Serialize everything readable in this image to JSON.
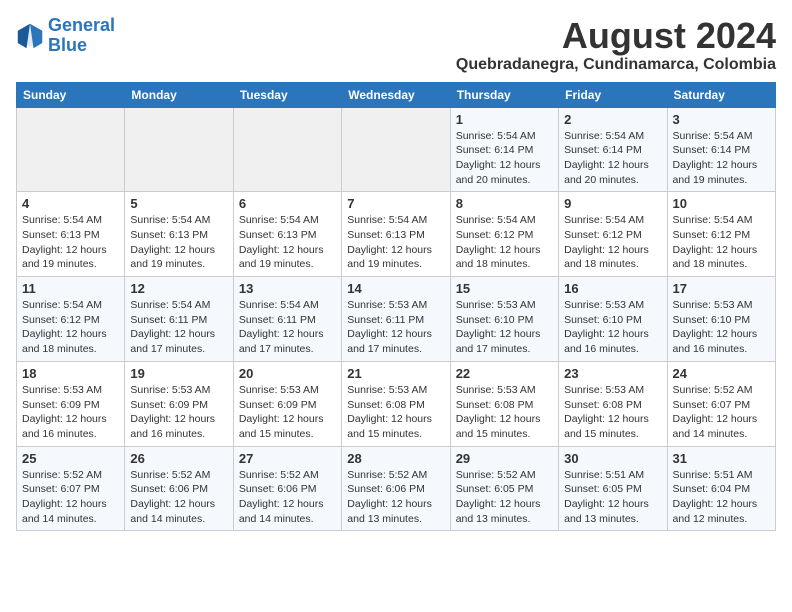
{
  "header": {
    "logo_line1": "General",
    "logo_line2": "Blue",
    "title": "August 2024",
    "subtitle": "Quebradanegra, Cundinamarca, Colombia"
  },
  "weekdays": [
    "Sunday",
    "Monday",
    "Tuesday",
    "Wednesday",
    "Thursday",
    "Friday",
    "Saturday"
  ],
  "weeks": [
    [
      {
        "day": "",
        "info": ""
      },
      {
        "day": "",
        "info": ""
      },
      {
        "day": "",
        "info": ""
      },
      {
        "day": "",
        "info": ""
      },
      {
        "day": "1",
        "info": "Sunrise: 5:54 AM\nSunset: 6:14 PM\nDaylight: 12 hours\nand 20 minutes."
      },
      {
        "day": "2",
        "info": "Sunrise: 5:54 AM\nSunset: 6:14 PM\nDaylight: 12 hours\nand 20 minutes."
      },
      {
        "day": "3",
        "info": "Sunrise: 5:54 AM\nSunset: 6:14 PM\nDaylight: 12 hours\nand 19 minutes."
      }
    ],
    [
      {
        "day": "4",
        "info": "Sunrise: 5:54 AM\nSunset: 6:13 PM\nDaylight: 12 hours\nand 19 minutes."
      },
      {
        "day": "5",
        "info": "Sunrise: 5:54 AM\nSunset: 6:13 PM\nDaylight: 12 hours\nand 19 minutes."
      },
      {
        "day": "6",
        "info": "Sunrise: 5:54 AM\nSunset: 6:13 PM\nDaylight: 12 hours\nand 19 minutes."
      },
      {
        "day": "7",
        "info": "Sunrise: 5:54 AM\nSunset: 6:13 PM\nDaylight: 12 hours\nand 19 minutes."
      },
      {
        "day": "8",
        "info": "Sunrise: 5:54 AM\nSunset: 6:12 PM\nDaylight: 12 hours\nand 18 minutes."
      },
      {
        "day": "9",
        "info": "Sunrise: 5:54 AM\nSunset: 6:12 PM\nDaylight: 12 hours\nand 18 minutes."
      },
      {
        "day": "10",
        "info": "Sunrise: 5:54 AM\nSunset: 6:12 PM\nDaylight: 12 hours\nand 18 minutes."
      }
    ],
    [
      {
        "day": "11",
        "info": "Sunrise: 5:54 AM\nSunset: 6:12 PM\nDaylight: 12 hours\nand 18 minutes."
      },
      {
        "day": "12",
        "info": "Sunrise: 5:54 AM\nSunset: 6:11 PM\nDaylight: 12 hours\nand 17 minutes."
      },
      {
        "day": "13",
        "info": "Sunrise: 5:54 AM\nSunset: 6:11 PM\nDaylight: 12 hours\nand 17 minutes."
      },
      {
        "day": "14",
        "info": "Sunrise: 5:53 AM\nSunset: 6:11 PM\nDaylight: 12 hours\nand 17 minutes."
      },
      {
        "day": "15",
        "info": "Sunrise: 5:53 AM\nSunset: 6:10 PM\nDaylight: 12 hours\nand 17 minutes."
      },
      {
        "day": "16",
        "info": "Sunrise: 5:53 AM\nSunset: 6:10 PM\nDaylight: 12 hours\nand 16 minutes."
      },
      {
        "day": "17",
        "info": "Sunrise: 5:53 AM\nSunset: 6:10 PM\nDaylight: 12 hours\nand 16 minutes."
      }
    ],
    [
      {
        "day": "18",
        "info": "Sunrise: 5:53 AM\nSunset: 6:09 PM\nDaylight: 12 hours\nand 16 minutes."
      },
      {
        "day": "19",
        "info": "Sunrise: 5:53 AM\nSunset: 6:09 PM\nDaylight: 12 hours\nand 16 minutes."
      },
      {
        "day": "20",
        "info": "Sunrise: 5:53 AM\nSunset: 6:09 PM\nDaylight: 12 hours\nand 15 minutes."
      },
      {
        "day": "21",
        "info": "Sunrise: 5:53 AM\nSunset: 6:08 PM\nDaylight: 12 hours\nand 15 minutes."
      },
      {
        "day": "22",
        "info": "Sunrise: 5:53 AM\nSunset: 6:08 PM\nDaylight: 12 hours\nand 15 minutes."
      },
      {
        "day": "23",
        "info": "Sunrise: 5:53 AM\nSunset: 6:08 PM\nDaylight: 12 hours\nand 15 minutes."
      },
      {
        "day": "24",
        "info": "Sunrise: 5:52 AM\nSunset: 6:07 PM\nDaylight: 12 hours\nand 14 minutes."
      }
    ],
    [
      {
        "day": "25",
        "info": "Sunrise: 5:52 AM\nSunset: 6:07 PM\nDaylight: 12 hours\nand 14 minutes."
      },
      {
        "day": "26",
        "info": "Sunrise: 5:52 AM\nSunset: 6:06 PM\nDaylight: 12 hours\nand 14 minutes."
      },
      {
        "day": "27",
        "info": "Sunrise: 5:52 AM\nSunset: 6:06 PM\nDaylight: 12 hours\nand 14 minutes."
      },
      {
        "day": "28",
        "info": "Sunrise: 5:52 AM\nSunset: 6:06 PM\nDaylight: 12 hours\nand 13 minutes."
      },
      {
        "day": "29",
        "info": "Sunrise: 5:52 AM\nSunset: 6:05 PM\nDaylight: 12 hours\nand 13 minutes."
      },
      {
        "day": "30",
        "info": "Sunrise: 5:51 AM\nSunset: 6:05 PM\nDaylight: 12 hours\nand 13 minutes."
      },
      {
        "day": "31",
        "info": "Sunrise: 5:51 AM\nSunset: 6:04 PM\nDaylight: 12 hours\nand 12 minutes."
      }
    ]
  ]
}
